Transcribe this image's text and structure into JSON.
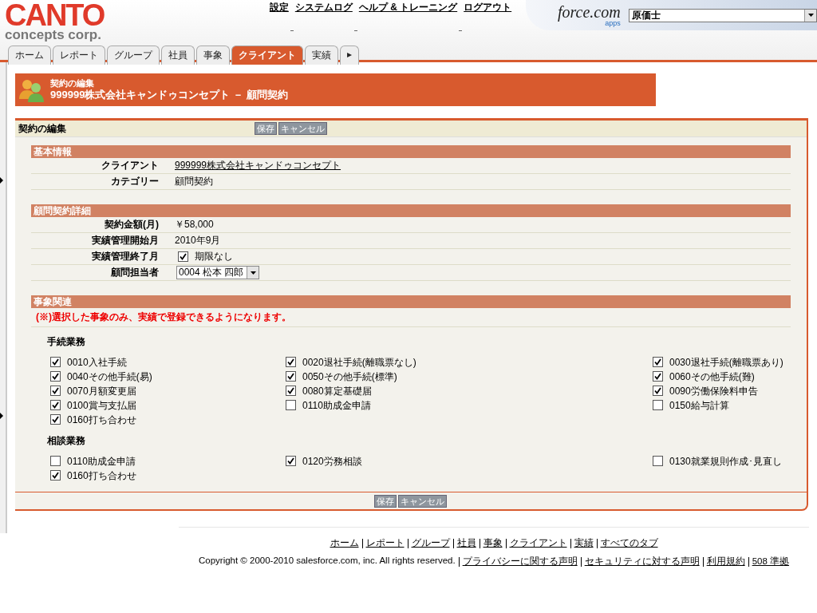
{
  "header": {
    "logo_top": "CANTO",
    "logo_bottom": "concepts corp.",
    "links": [
      "設定",
      "システムログ",
      "ヘルプ & トレーニング",
      "ログアウト"
    ],
    "brand": "force.com",
    "brand_sub": "apps",
    "app_select": "原価士"
  },
  "tabs": [
    {
      "label": "ホーム",
      "selected": false
    },
    {
      "label": "レポート",
      "selected": false
    },
    {
      "label": "グループ",
      "selected": false
    },
    {
      "label": "社員",
      "selected": false
    },
    {
      "label": "事象",
      "selected": false
    },
    {
      "label": "クライアント",
      "selected": true
    },
    {
      "label": "実績",
      "selected": false
    },
    {
      "label": "▸",
      "selected": false
    }
  ],
  "page_title": {
    "subtitle": "契約の編集",
    "title": "999999株式会社キャンドゥコンセプト － 顧問契約"
  },
  "form": {
    "title": "契約の編集",
    "buttons": [
      "保存",
      "キャンセル"
    ],
    "bottom_buttons": [
      "保存",
      "キャンセル"
    ],
    "sections": [
      {
        "kind": "fields",
        "title": "基本情報",
        "fields": [
          {
            "kind": "link",
            "label": "クライアント",
            "value": "999999株式会社キャンドゥコンセプト"
          },
          {
            "kind": "text",
            "label": "カテゴリー",
            "value": "顧問契約"
          }
        ]
      },
      {
        "kind": "fields",
        "title": "顧問契約詳細",
        "fields": [
          {
            "kind": "text",
            "label": "契約金額(月)",
            "value": "￥58,000"
          },
          {
            "kind": "text",
            "label": "実績管理開始月",
            "value": "2010年9月"
          },
          {
            "kind": "checkbox",
            "label": "実績管理終了月",
            "value": "期限なし",
            "checked": true
          },
          {
            "kind": "select",
            "label": "顧問担当者",
            "value": "0004 松本 四郎"
          }
        ]
      },
      {
        "kind": "checks",
        "title": "事象関連",
        "note": "(※)選択した事象のみ、実績で登録できるようになります。",
        "groups": [
          {
            "title": "手続業務",
            "columns": [
              [
                {
                  "label": "0010入社手続",
                  "checked": true
                },
                {
                  "label": "0040その他手続(易)",
                  "checked": true
                },
                {
                  "label": "0070月額変更届",
                  "checked": true
                },
                {
                  "label": "0100賞与支払届",
                  "checked": true
                },
                {
                  "label": "0160打ち合わせ",
                  "checked": true
                }
              ],
              [
                {
                  "label": "0020退社手続(離職票なし)",
                  "checked": true
                },
                {
                  "label": "0050その他手続(標準)",
                  "checked": true
                },
                {
                  "label": "0080算定基礎届",
                  "checked": true
                },
                {
                  "label": "0110助成金申請",
                  "checked": false
                }
              ],
              [
                {
                  "label": "0030退社手続(離職票あり)",
                  "checked": true
                },
                {
                  "label": "0060その他手続(難)",
                  "checked": true
                },
                {
                  "label": "0090労働保険料申告",
                  "checked": true
                },
                {
                  "label": "0150給与計算",
                  "checked": false
                }
              ]
            ]
          },
          {
            "title": "相談業務",
            "columns": [
              [
                {
                  "label": "0110助成金申請",
                  "checked": false
                },
                {
                  "label": "0160打ち合わせ",
                  "checked": true
                }
              ],
              [
                {
                  "label": "0120労務相談",
                  "checked": true
                }
              ],
              [
                {
                  "label": "0130就業規則作成･見直し",
                  "checked": false
                }
              ]
            ]
          }
        ]
      }
    ]
  },
  "footer": {
    "links": [
      "ホーム",
      "レポート",
      "グループ",
      "社員",
      "事象",
      "クライアント",
      "実績",
      "すべてのタブ"
    ],
    "copyright": "Copyright © 2000-2010 salesforce.com, inc. All rights reserved.",
    "legal": [
      "プライバシーに関する声明",
      "セキュリティに対する声明",
      "利用規約",
      "508 準拠"
    ]
  }
}
